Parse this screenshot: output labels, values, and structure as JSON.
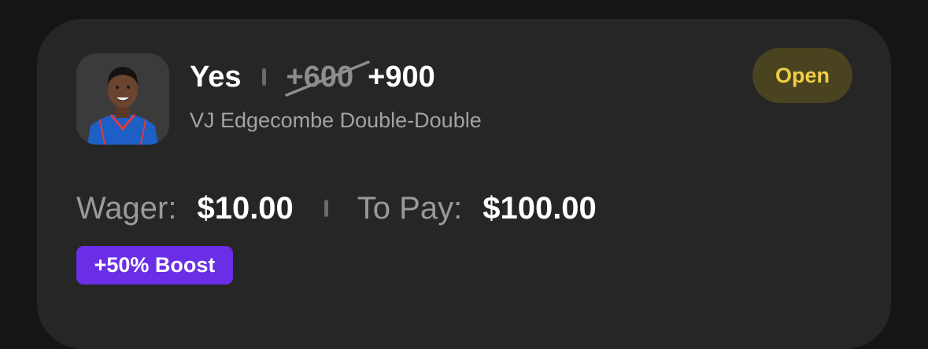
{
  "bet": {
    "pick": "Yes",
    "original_odds": "+600",
    "boosted_odds": "+900",
    "market": "VJ Edgecombe Double-Double",
    "status": "Open"
  },
  "amounts": {
    "wager_label": "Wager:",
    "wager_value": "$10.00",
    "to_pay_label": "To Pay:",
    "to_pay_value": "$100.00"
  },
  "boost": {
    "label": "+50% Boost"
  },
  "colors": {
    "card_bg": "#262626",
    "page_bg": "#151515",
    "status_text": "#f2cd45",
    "status_bg": "#4a4320",
    "boost_bg": "#6a2ee6",
    "jersey": "#1d5fc4"
  },
  "icons": {
    "avatar": "player-headshot",
    "separator": "vertical-divider"
  }
}
